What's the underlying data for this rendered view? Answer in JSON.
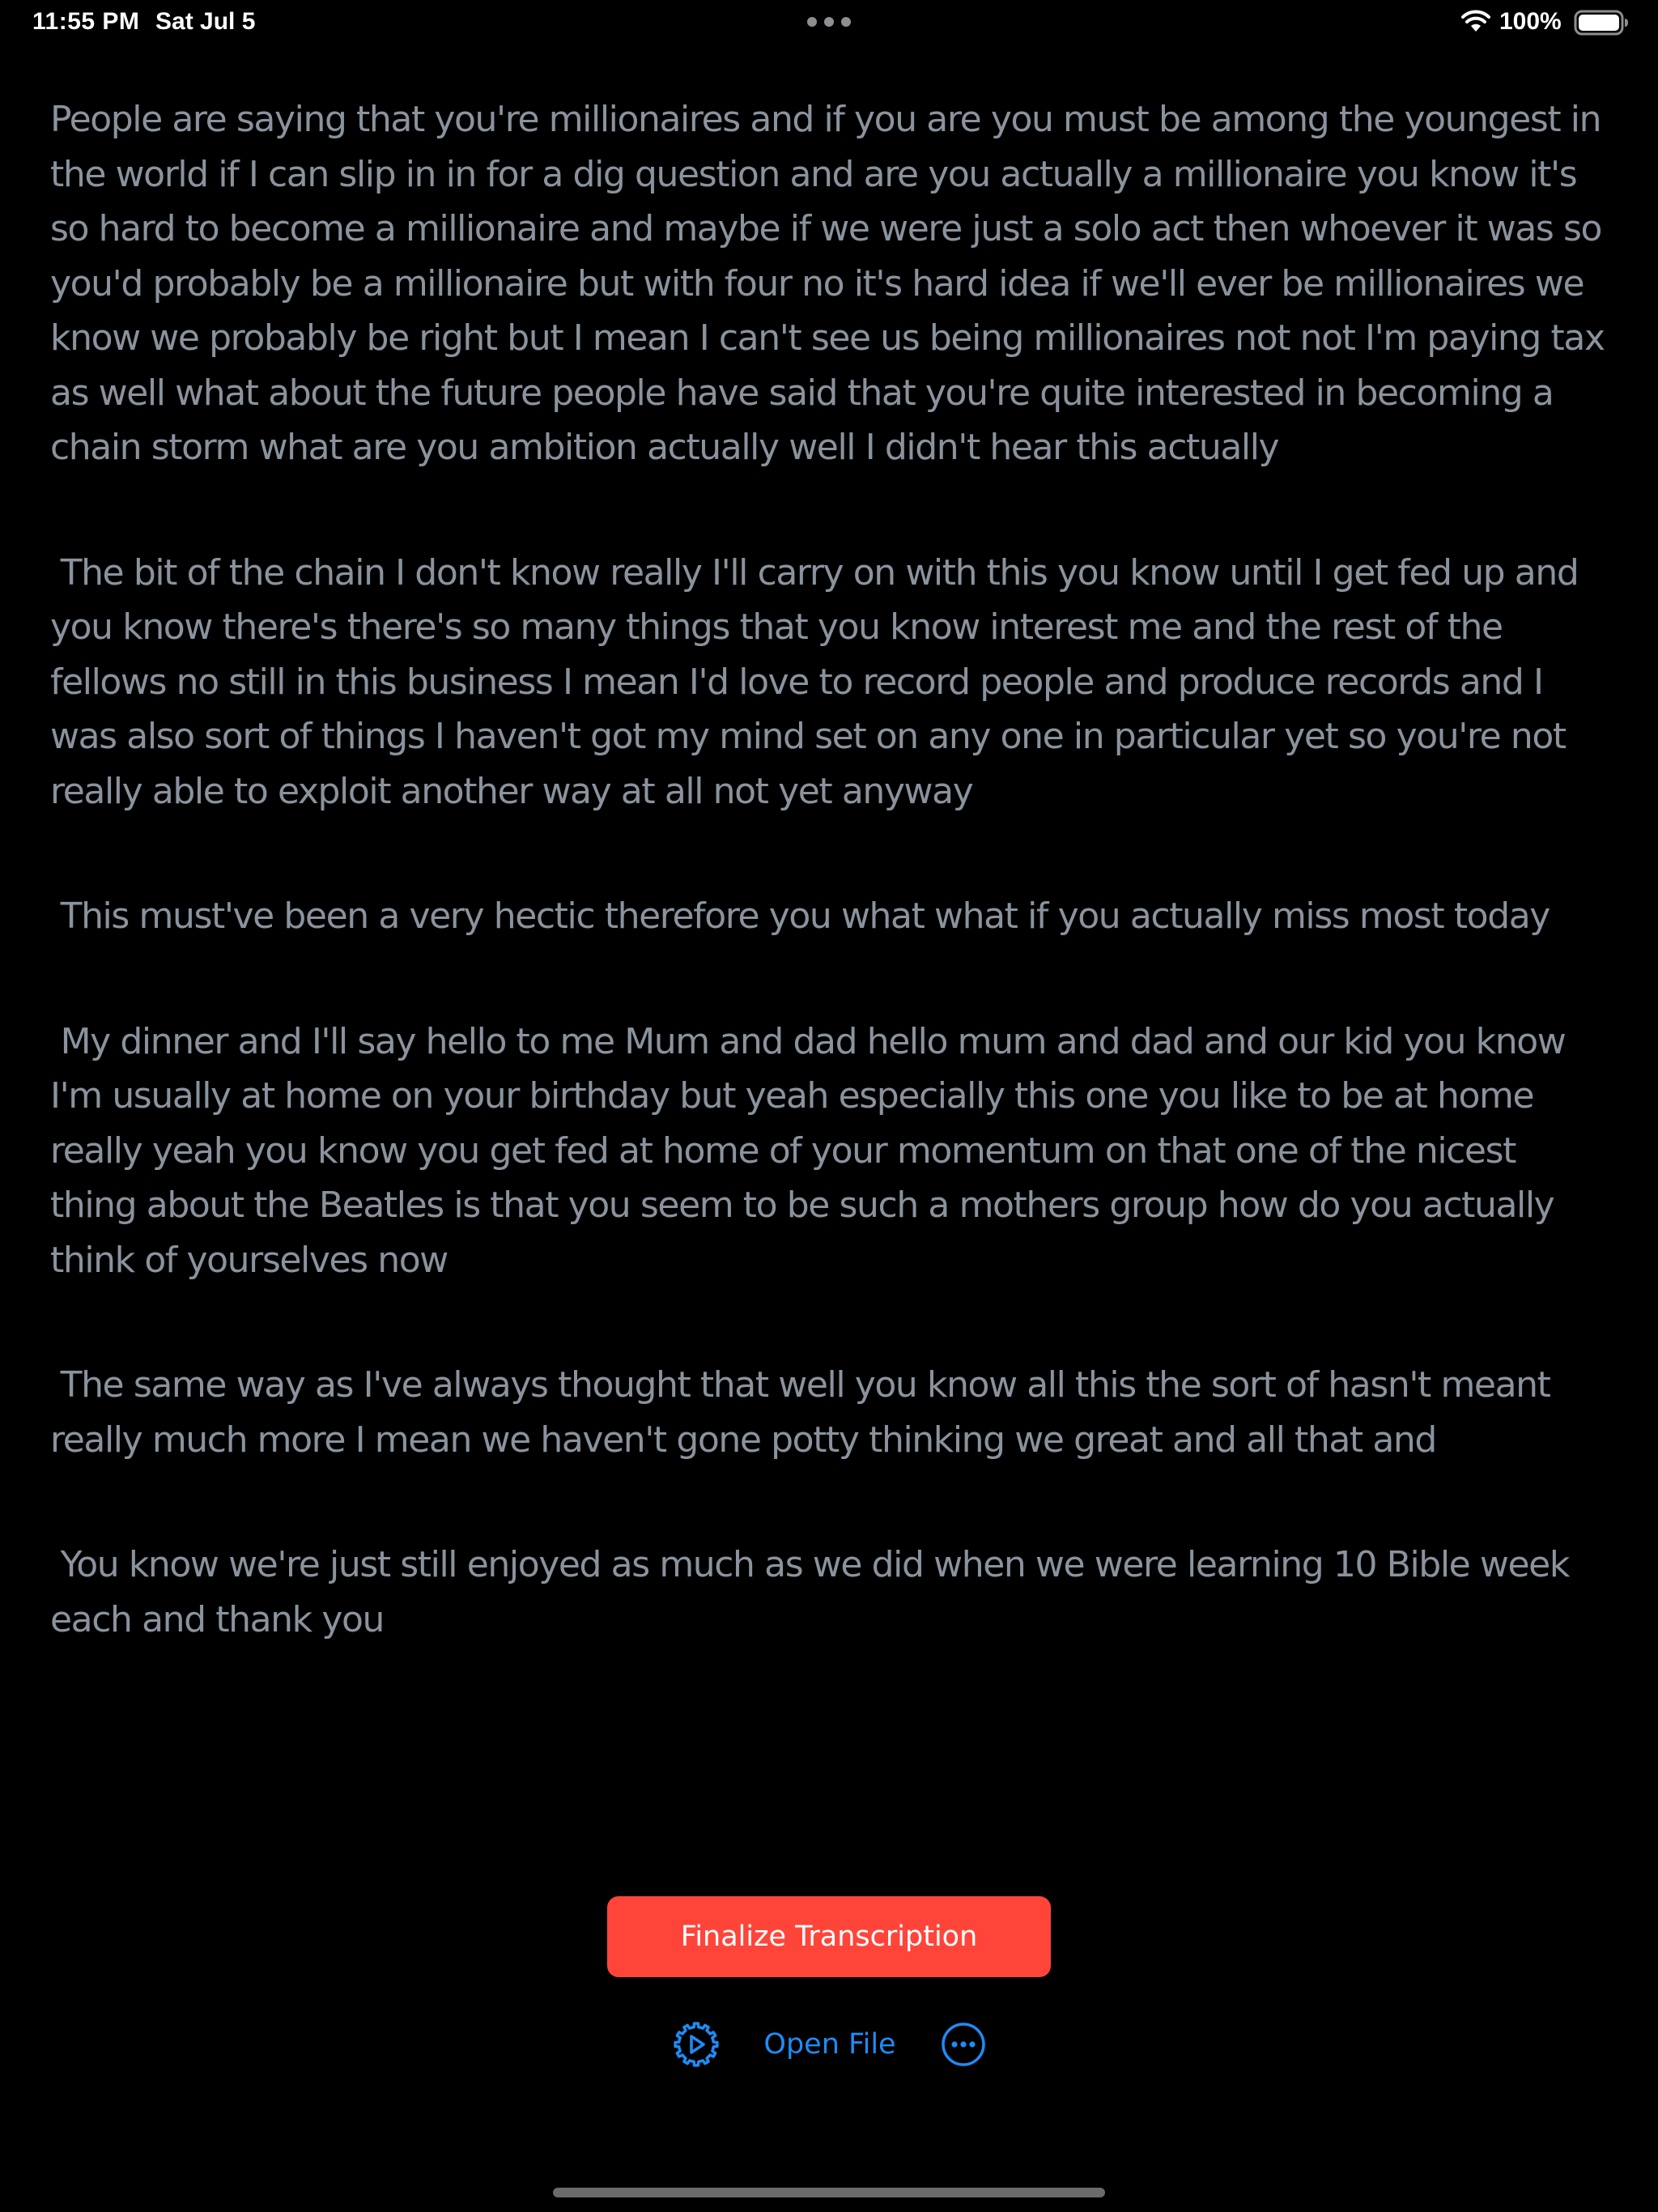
{
  "status_bar": {
    "time": "11:55 PM",
    "date": "Sat Jul 5",
    "battery_percent": "100%",
    "battery_level": 1.0,
    "icons": [
      "multitasking-dots-icon",
      "wifi-icon",
      "battery-icon"
    ]
  },
  "transcript": {
    "paragraphs": [
      "People are saying that you're millionaires and if you are you must be among the youngest in the world if I can slip in in for a dig question and are you actually a millionaire you know it's so hard to become a millionaire and maybe if we were just a solo act then whoever it was so you'd probably be a millionaire but with four no it's hard idea if we'll ever be millionaires we know we probably be right but I mean I can't see us being millionaires not not I'm paying tax as well what about the future people have said that you're quite interested in becoming a chain storm what are you ambition actually well I didn't hear this actually",
      " The bit of the chain I don't know really I'll carry on with this you know until I get fed up and you know there's there's so many things that you know interest me and the rest of the fellows no still in this business I mean I'd love to record people and produce records and I was also sort of things I haven't got my mind set on any one in particular yet so you're not really able to exploit another way at all not yet anyway",
      " This must've been a very hectic therefore you what what if you actually miss most today",
      " My dinner and I'll say hello to me Mum and dad hello mum and dad and our kid you know I'm usually at home on your birthday but yeah especially this one you like to be at home really yeah you know you get fed at home of your momentum on that one of the nicest thing about the Beatles is that you seem to be such a mothers group how do you actually think of yourselves now",
      " The same way as I've always thought that well you know all this the sort of hasn't meant really much more I mean we haven't gone potty thinking we great and all that and",
      " You know we're just still enjoyed as much as we did when we were learning 10 Bible week each and thank you"
    ]
  },
  "actions": {
    "finalize_label": "Finalize Transcription",
    "open_file_label": "Open File",
    "settings_icon": "gear-icon",
    "more_icon": "ellipsis-circle-icon"
  },
  "colors": {
    "background": "#000000",
    "transcript_text": "#8a939d",
    "accent": "#1e8cf5",
    "finalize_button": "#ff453a"
  }
}
